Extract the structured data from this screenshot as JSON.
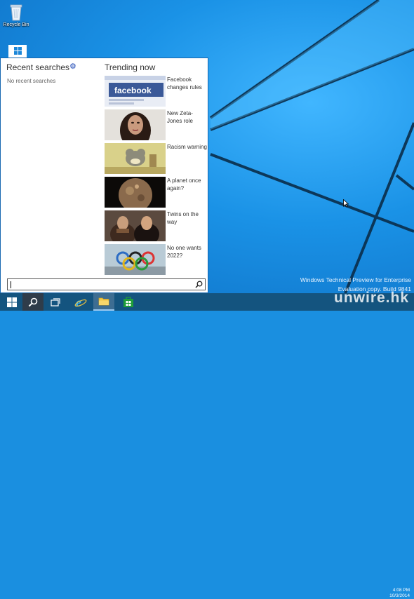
{
  "desktop": {
    "icons": [
      {
        "label": "Recycle Bin",
        "icon": "recycle-bin-icon"
      },
      {
        "label": "",
        "icon": "windows-logo-icon"
      }
    ]
  },
  "search_panel": {
    "recent": {
      "title": "Recent searches",
      "settings_icon": "gear-icon",
      "empty_text": "No recent searches"
    },
    "trending": {
      "title": "Trending now",
      "items": [
        {
          "label": "Facebook changes rules",
          "thumb_text": "facebook"
        },
        {
          "label": "New Zeta-Jones role"
        },
        {
          "label": "Racism warning"
        },
        {
          "label": "A planet once again?"
        },
        {
          "label": "Twins on the way"
        },
        {
          "label": "No one wants 2022?"
        }
      ]
    },
    "search_box": {
      "value": "",
      "button_icon": "search-icon"
    }
  },
  "taskbar": {
    "buttons": [
      {
        "name": "start",
        "icon": "windows-logo-icon"
      },
      {
        "name": "search",
        "icon": "search-icon"
      },
      {
        "name": "task-view",
        "icon": "task-view-icon"
      },
      {
        "name": "internet-explorer",
        "icon": "internet-explorer-icon"
      },
      {
        "name": "file-explorer",
        "icon": "folder-icon"
      },
      {
        "name": "store",
        "icon": "store-icon"
      }
    ],
    "tray": {
      "time": "4:08 PM",
      "date": "10/3/2014"
    }
  },
  "watermark": {
    "line1": "Windows Technical Preview for Enterprise",
    "line2": "Evaluation copy. Build 9841"
  },
  "brand": "unwire.hk",
  "colors": {
    "accent": "#1f49b5",
    "taskbar": "#14547f",
    "desktop": "#1a8fe0"
  }
}
